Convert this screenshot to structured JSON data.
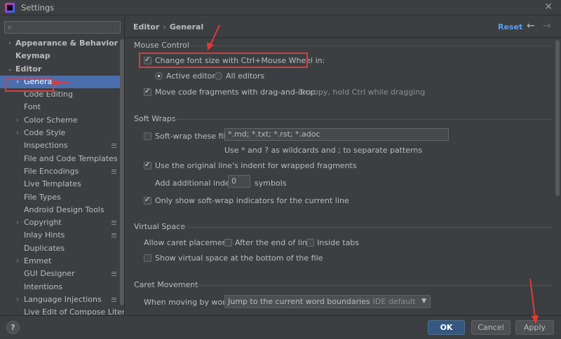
{
  "window": {
    "title": "Settings"
  },
  "search": {
    "placeholder": "",
    "value": ""
  },
  "tree": [
    {
      "label": "Appearance & Behavior",
      "level": 0,
      "arrow": "›"
    },
    {
      "label": "Keymap",
      "level": 0,
      "arrow": ""
    },
    {
      "label": "Editor",
      "level": 0,
      "arrow": "⌄"
    },
    {
      "label": "General",
      "level": 1,
      "arrow": "›",
      "selected": true
    },
    {
      "label": "Code Editing",
      "level": 1,
      "arrow": ""
    },
    {
      "label": "Font",
      "level": 1,
      "arrow": ""
    },
    {
      "label": "Color Scheme",
      "level": 1,
      "arrow": "›"
    },
    {
      "label": "Code Style",
      "level": 1,
      "arrow": "›"
    },
    {
      "label": "Inspections",
      "level": 1,
      "arrow": "",
      "badge": true
    },
    {
      "label": "File and Code Templates",
      "level": 1,
      "arrow": ""
    },
    {
      "label": "File Encodings",
      "level": 1,
      "arrow": "",
      "badge": true
    },
    {
      "label": "Live Templates",
      "level": 1,
      "arrow": ""
    },
    {
      "label": "File Types",
      "level": 1,
      "arrow": ""
    },
    {
      "label": "Android Design Tools",
      "level": 1,
      "arrow": ""
    },
    {
      "label": "Copyright",
      "level": 1,
      "arrow": "›",
      "badge": true
    },
    {
      "label": "Inlay Hints",
      "level": 1,
      "arrow": "",
      "badge": true
    },
    {
      "label": "Duplicates",
      "level": 1,
      "arrow": ""
    },
    {
      "label": "Emmet",
      "level": 1,
      "arrow": "›"
    },
    {
      "label": "GUI Designer",
      "level": 1,
      "arrow": "",
      "badge": true
    },
    {
      "label": "Intentions",
      "level": 1,
      "arrow": ""
    },
    {
      "label": "Language Injections",
      "level": 1,
      "arrow": "›",
      "badge": true
    },
    {
      "label": "Live Edit of Compose Literals",
      "level": 1,
      "arrow": ""
    }
  ],
  "header": {
    "crumb_parent": "Editor",
    "crumb_sep": "›",
    "crumb_current": "General",
    "reset": "Reset",
    "back_icon": "←",
    "forward_icon": "→"
  },
  "mouse": {
    "title": "Mouse Control",
    "change_font": "Change font size with Ctrl+Mouse Wheel in:",
    "active_editor": "Active editor",
    "all_editors": "All editors",
    "move_fragments": "Move code fragments with drag-and-drop",
    "move_hint": "To copy, hold Ctrl while dragging"
  },
  "soft_wraps": {
    "title": "Soft Wraps",
    "soft_wrap_files": "Soft-wrap these files:",
    "files_value": "*.md; *.txt; *.rst; *.adoc",
    "patterns_hint": "Use * and ? as wildcards and ; to separate patterns",
    "original_indent": "Use the original line's indent for wrapped fragments",
    "add_indent": "Add additional indent:",
    "indent_value": "0",
    "symbols": "symbols",
    "only_show": "Only show soft-wrap indicators for the current line"
  },
  "virtual_space": {
    "title": "Virtual Space",
    "allow_caret": "Allow caret placement:",
    "after_end": "After the end of line",
    "inside_tabs": "Inside tabs",
    "show_virtual": "Show virtual space at the bottom of the file"
  },
  "caret": {
    "title": "Caret Movement",
    "moving_by_words": "When moving by words:",
    "words_value": "Jump to the current word boundaries",
    "words_hint": "IDE default"
  },
  "footer": {
    "help": "?",
    "ok": "OK",
    "cancel": "Cancel",
    "apply": "Apply"
  },
  "colors": {
    "selection": "#4b6eaf",
    "link": "#589df6",
    "annotation": "#e53935"
  }
}
